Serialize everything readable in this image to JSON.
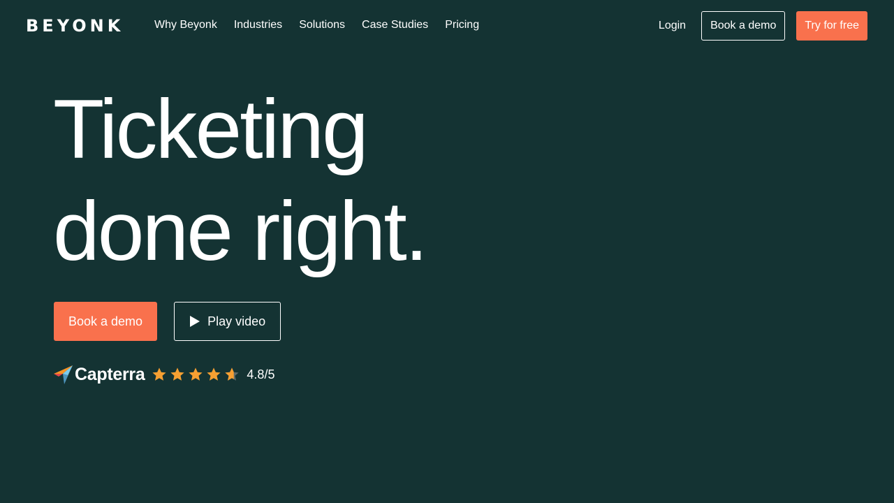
{
  "brand": {
    "name": "BEYONK"
  },
  "nav": {
    "links": [
      "Why Beyonk",
      "Industries",
      "Solutions",
      "Case Studies",
      "Pricing"
    ],
    "login": "Login",
    "book_demo": "Book a demo",
    "try_free": "Try for free"
  },
  "hero": {
    "title_line1": "Ticketing",
    "title_line2": "done right.",
    "primary_cta": "Book a demo",
    "secondary_cta": "Play video"
  },
  "rating": {
    "provider": "Capterra",
    "stars": 4.8,
    "max": 5,
    "label": "4.8/5"
  },
  "colors": {
    "background": "#143333",
    "accent": "#f9714d",
    "star": "#f7a032",
    "text": "#ffffff"
  },
  "icons": [
    "play-icon",
    "capterra-logo-icon",
    "star-icon"
  ]
}
